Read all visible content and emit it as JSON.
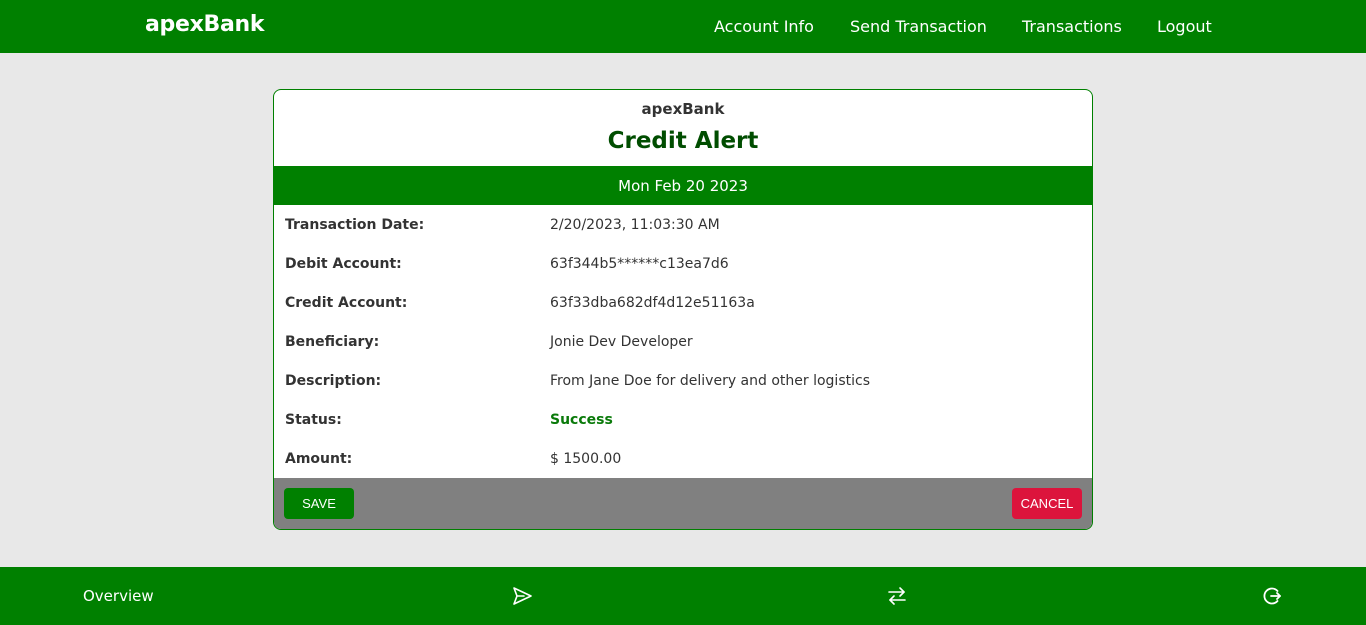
{
  "header": {
    "brand": "apexBank",
    "nav": [
      "Account Info",
      "Send Transaction",
      "Transactions",
      "Logout"
    ]
  },
  "card": {
    "brand": "apexBank",
    "title": "Credit Alert",
    "date_band": "Mon Feb 20 2023",
    "rows": [
      {
        "label": "Transaction Date:",
        "value": "2/20/2023, 11:03:30 AM"
      },
      {
        "label": "Debit Account:",
        "value": "63f344b5******c13ea7d6"
      },
      {
        "label": "Credit Account:",
        "value": "63f33dba682df4d12e51163a"
      },
      {
        "label": "Beneficiary:",
        "value": "Jonie Dev Developer"
      },
      {
        "label": "Description:",
        "value": "From Jane Doe for delivery and other logistics"
      },
      {
        "label": "Status:",
        "value": "Success"
      },
      {
        "label": "Amount:",
        "value": "$ 1500.00"
      }
    ],
    "save_label": "SAVE",
    "cancel_label": "CANCEL"
  },
  "bottom_nav": {
    "overview_label": "Overview",
    "icons": [
      "send-icon",
      "transfer-arrows-icon",
      "logout-icon"
    ]
  },
  "colors": {
    "primary": "#008000",
    "title": "#004d00",
    "cancel": "#dc143c",
    "footer_gray": "#808080",
    "background": "#e8e8e8"
  }
}
